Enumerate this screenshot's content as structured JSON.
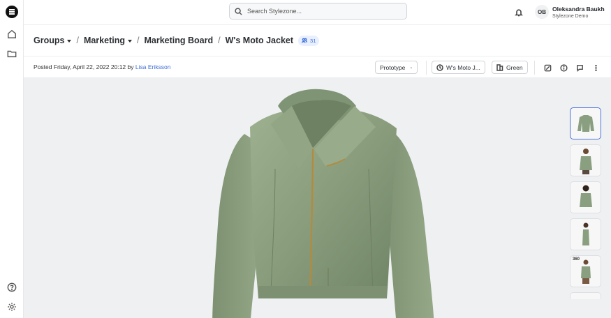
{
  "app": {
    "search_placeholder": "Search Stylezone..."
  },
  "user": {
    "initials": "OB",
    "name": "Oleksandra Baukh",
    "org": "Stylezone Demo"
  },
  "breadcrumb": {
    "items": [
      "Groups",
      "Marketing",
      "Marketing Board",
      "W's Moto Jacket"
    ],
    "member_count": "31"
  },
  "post": {
    "posted_prefix": "Posted Friday, April 22, 2022 20:12 by",
    "author": "Lisa Eriksson"
  },
  "toolbar": {
    "stage": "Prototype",
    "version": "W's Moto J...",
    "colorway": "Green"
  },
  "thumbnails": [
    {
      "label": "",
      "selected": true
    },
    {
      "label": "",
      "selected": false
    },
    {
      "label": "",
      "selected": false
    },
    {
      "label": "",
      "selected": false
    },
    {
      "label": "360",
      "selected": false
    }
  ],
  "colors": {
    "accent": "#3f6fd8",
    "jacket": "#8a9f7f"
  }
}
